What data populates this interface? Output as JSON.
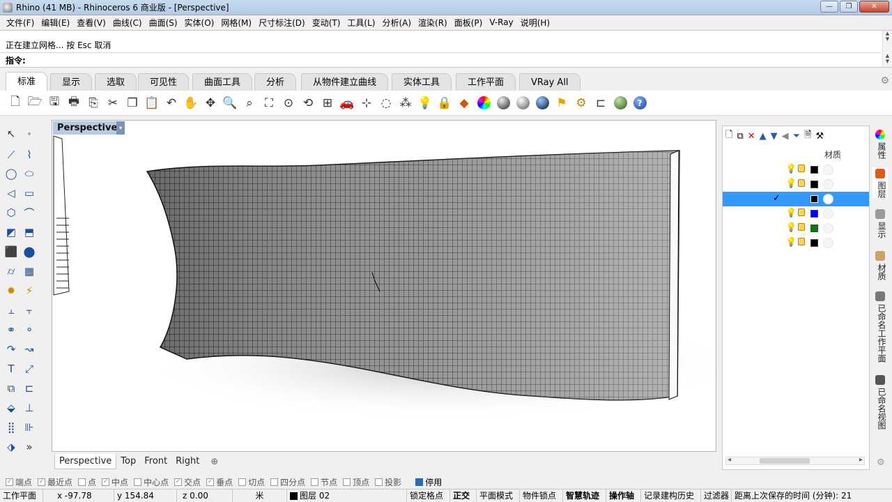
{
  "window": {
    "title": "Rhino (41 MB) - Rhinoceros 6 商业版 - [Perspective]",
    "minimize": "—",
    "maximize": "❐",
    "close": "✕"
  },
  "menu": [
    "文件(F)",
    "编辑(E)",
    "查看(V)",
    "曲线(C)",
    "曲面(S)",
    "实体(O)",
    "网格(M)",
    "尺寸标注(D)",
    "变动(T)",
    "工具(L)",
    "分析(A)",
    "渲染(R)",
    "面板(P)",
    "V-Ray",
    "说明(H)"
  ],
  "command": {
    "history": "正在建立网格... 按 Esc 取消",
    "prompt": "指令:",
    "value": ""
  },
  "tabs": [
    "标准",
    "显示",
    "选取",
    "可见性",
    "曲面工具",
    "分析",
    "从物件建立曲线",
    "实体工具",
    "工作平面",
    "VRay All"
  ],
  "toolbar_icons": [
    "new-file-icon",
    "open-file-icon",
    "save-icon",
    "print-icon",
    "import-icon",
    "cut-icon",
    "copy-icon",
    "paste-icon",
    "undo-icon",
    "pan-icon",
    "move-icon",
    "zoom-icon",
    "zoom-window-icon",
    "zoom-extents-icon",
    "zoom-selected-icon",
    "rotate-view-icon",
    "four-view-icon",
    "car-icon",
    "grid-icon",
    "circle-icon",
    "points-icon",
    "bulb-icon",
    "lock-icon",
    "layer-icon",
    "color-wheel-icon",
    "shaded-sphere-icon",
    "rendered-sphere-icon",
    "blue-sphere-icon",
    "render-icon",
    "options-gear-icon",
    "dimension-icon",
    "globe-icon",
    "help-icon"
  ],
  "viewport": {
    "title": "Perspective",
    "dropdown": "▾"
  },
  "viewport_tabs": [
    "Perspective",
    "Top",
    "Front",
    "Right"
  ],
  "viewport_tab_add": "⊕",
  "panel": {
    "column_header": "材质",
    "layers": [
      {
        "color": "#000000",
        "checked": false,
        "selected": false
      },
      {
        "color": "#000000",
        "checked": false,
        "selected": false
      },
      {
        "color": "#000000",
        "checked": true,
        "selected": true
      },
      {
        "color": "#0000ff",
        "checked": false,
        "selected": false
      },
      {
        "color": "#008000",
        "checked": false,
        "selected": false
      },
      {
        "color": "#000000",
        "checked": false,
        "selected": false
      }
    ],
    "check_glyph": "✓",
    "scroll_left": "◂",
    "scroll_right": "▸"
  },
  "side_tabs": [
    "属性",
    "图层",
    "显示",
    "材质",
    "已命名工作平面",
    "已命名视图"
  ],
  "osnaps": [
    {
      "label": "端点",
      "on": true
    },
    {
      "label": "最近点",
      "on": true
    },
    {
      "label": "点",
      "on": false
    },
    {
      "label": "中点",
      "on": true
    },
    {
      "label": "中心点",
      "on": false
    },
    {
      "label": "交点",
      "on": true
    },
    {
      "label": "垂点",
      "on": true
    },
    {
      "label": "切点",
      "on": false
    },
    {
      "label": "四分点",
      "on": false
    },
    {
      "label": "节点",
      "on": false
    },
    {
      "label": "顶点",
      "on": false
    },
    {
      "label": "投影",
      "on": false
    }
  ],
  "osnap_disable": "停用",
  "status": {
    "cplane": "工作平面",
    "x": "x -97.78",
    "y": "y 154.84",
    "z": "z 0.00",
    "units": "米",
    "layer": "图层 02",
    "grid_snap": "锁定格点",
    "ortho": "正交",
    "planar": "平面模式",
    "osnap": "物件锁点",
    "smarttrack": "智慧轨迹",
    "gumball": "操作轴",
    "history": "记录建构历史",
    "filter": "过滤器",
    "autosave": "距离上次保存的时间 (分钟): 21"
  }
}
